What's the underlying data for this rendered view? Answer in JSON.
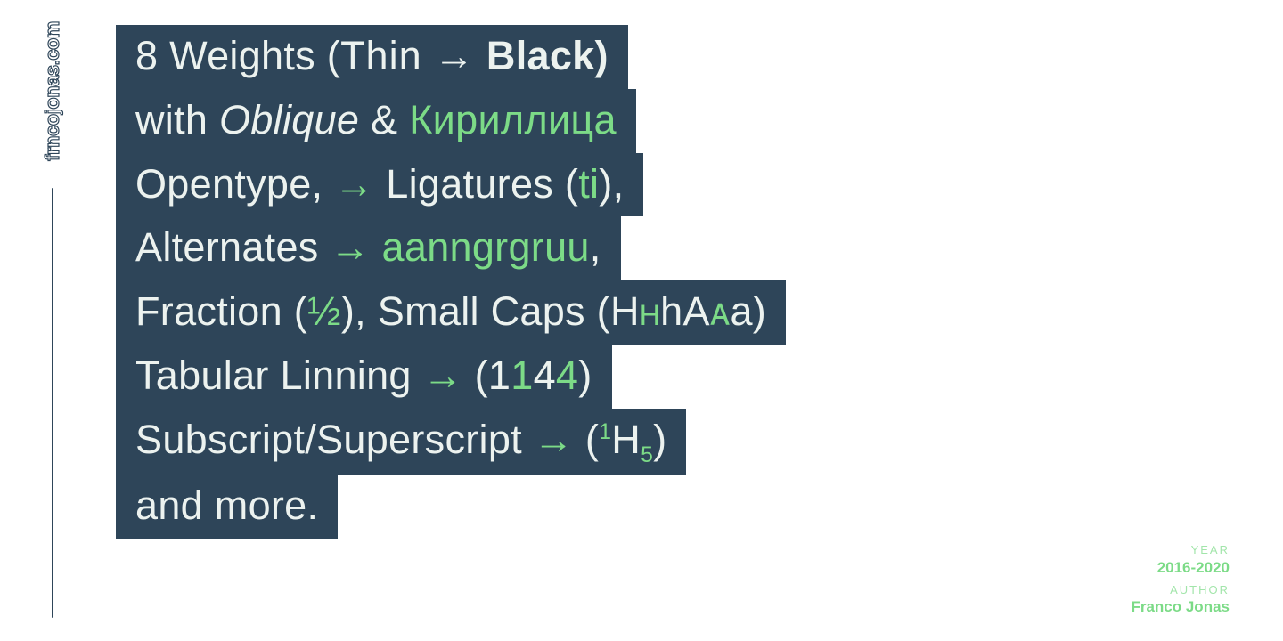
{
  "site": "frncojonas.com",
  "specimen": {
    "l1_a": "8 Weights (",
    "l1_thin": "Thin ",
    "l1_arrow": "→",
    "l1_black": " Black)",
    "l2_a": "with ",
    "l2_oblique": "Oblique",
    "l2_amp": " & ",
    "l2_cyr": "Кириллица",
    "l3_a": "Opentype, ",
    "l3_arrow": "→",
    "l3_b": " Ligatures (",
    "l3_lig": "ti",
    "l3_c": "),",
    "l4_a": "Alternates ",
    "l4_arrow": "→",
    "l4_b": " ",
    "l4_alt": "aanngrgruu",
    "l4_c": ",",
    "l5_a": "Fraction (",
    "l5_frac": "½",
    "l5_b": "), Small Caps (H",
    "l5_sc1": "н",
    "l5_c": "hA",
    "l5_sc2": "ᴀ",
    "l5_d": "a)",
    "l6_a": "Tabular Linning ",
    "l6_arrow": "→",
    "l6_b": " (1",
    "l6_n1": "1",
    "l6_c": "4",
    "l6_n2": "4",
    "l6_d": ")",
    "l7_a": "Subscript/Superscript ",
    "l7_arrow": "→",
    "l7_b": " (",
    "l7_sup": "1",
    "l7_c": "H",
    "l7_sub": "5",
    "l7_d": ")",
    "l8": "and more."
  },
  "meta": {
    "year_label": "YEAR",
    "year_value": "2016-2020",
    "author_label": "AUTHOR",
    "author_value": "Franco Jonas"
  }
}
